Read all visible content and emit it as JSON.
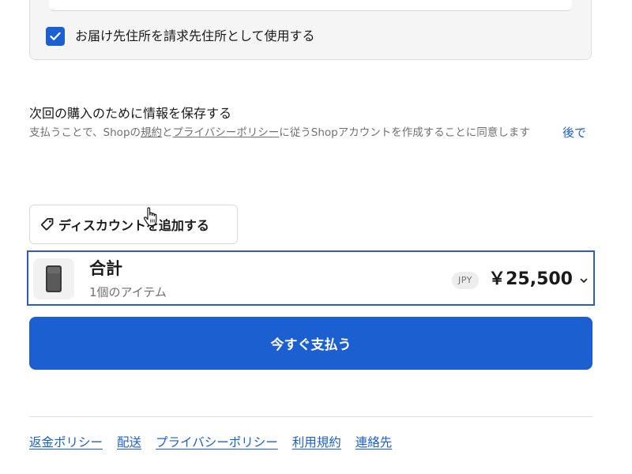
{
  "billing": {
    "checkbox_checked": true,
    "checkbox_label": "お届け先住所を請求先住所として使用する"
  },
  "save_info": {
    "title": "次回の購入のために情報を保存する",
    "desc_prefix": "支払うことで、Shopの",
    "terms_link": "規約",
    "desc_and": "と",
    "privacy_link": "プライバシーポリシー",
    "desc_suffix": "に従うShopアカウントを作成することに同意します",
    "later_label": "後で"
  },
  "discount": {
    "label": "ディスカウントを追加する",
    "icon": "tag-icon"
  },
  "summary": {
    "title": "合計",
    "item_count": "1個のアイテム",
    "currency": "JPY",
    "total": "￥25,500",
    "icon": "chevron-down-icon"
  },
  "pay_button": {
    "label": "今すぐ支払う"
  },
  "footer": {
    "links": [
      "返金ポリシー",
      "配送",
      "プライバシーポリシー",
      "利用規約",
      "連絡先"
    ]
  },
  "colors": {
    "accent": "#1b5fd1",
    "summary_border": "#2b5ebd",
    "muted_text": "#707070"
  }
}
